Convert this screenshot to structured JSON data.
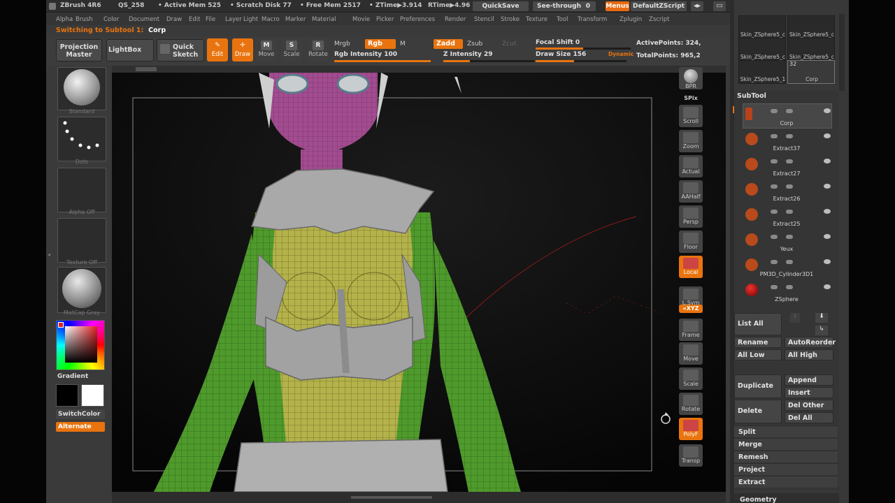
{
  "titlebar": {
    "app": "ZBrush 4R6",
    "qs": "QS_258",
    "active_mem": "• Active Mem 525",
    "scratch": "• Scratch Disk 77",
    "free_mem": "• Free Mem 2517",
    "ztime": "• ZTime▶3.914",
    "rtime": "RTime▶4.96",
    "quicksave": "QuickSave",
    "seethrough": "See-through",
    "seethrough_val": "0",
    "menus": "Menus",
    "script": "DefaultZScript"
  },
  "menu": [
    "Alpha",
    "Brush",
    "Color",
    "Document",
    "Draw",
    "Edit",
    "File",
    "Layer",
    "Light",
    "Macro",
    "Marker",
    "Material",
    "Movie",
    "Picker",
    "Preferences",
    "Render",
    "Stencil",
    "Stroke",
    "Texture",
    "Tool",
    "Transform",
    "Zplugin",
    "Zscript"
  ],
  "status": {
    "prefix": "Switching to Subtool 1:",
    "name": "Corp"
  },
  "shelf": {
    "projection": "Projection Master",
    "lightbox": "LightBox",
    "quick_sketch": "Quick Sketch",
    "edit": "Edit",
    "draw": "Draw",
    "move": "Move",
    "scale": "Scale",
    "rotate": "Rotate",
    "mrgb": "Mrgb",
    "rgb": "Rgb",
    "m": "M",
    "zadd": "Zadd",
    "zsub": "Zsub",
    "zcut": "Zcut",
    "rgb_intensity": "Rgb Intensity 100",
    "z_intensity": "Z Intensity 29",
    "focal_shift": "Focal Shift 0",
    "draw_size": "Draw Size 156",
    "dynamic": "Dynamic",
    "active_points": "ActivePoints: 324,",
    "total_points": "TotalPoints: 965,2",
    "rgb_intensity_level": 1.0,
    "z_intensity_level": 0.29,
    "focal_level": 0.5,
    "draw_size_level": 0.42
  },
  "left": {
    "standard": "Standard",
    "dots": "Dots",
    "alpha_off": "Alpha Off",
    "texture_off": "Texture Off",
    "matcap": "MatCap Gray",
    "gradient": "Gradient",
    "switch_color": "SwitchColor",
    "alternate": "Alternate"
  },
  "righttools": [
    {
      "key": "bpr",
      "label": "BPR"
    },
    {
      "key": "spix",
      "label": "SPix"
    },
    {
      "key": "scroll",
      "label": "Scroll"
    },
    {
      "key": "zoom",
      "label": "Zoom"
    },
    {
      "key": "actual",
      "label": "Actual"
    },
    {
      "key": "aahalf",
      "label": "AAHalf"
    },
    {
      "key": "persp",
      "label": "Persp"
    },
    {
      "key": "floor",
      "label": "Floor"
    },
    {
      "key": "local",
      "label": "Local"
    },
    {
      "key": "lsym",
      "label": "L.Sym"
    },
    {
      "key": "xyz",
      "label": "«XYZ"
    },
    {
      "key": "frame",
      "label": "Frame"
    },
    {
      "key": "move",
      "label": "Move"
    },
    {
      "key": "scale",
      "label": "Scale"
    },
    {
      "key": "rotate",
      "label": "Rotate"
    },
    {
      "key": "polyf",
      "label": "PolyF"
    },
    {
      "key": "transp",
      "label": "Transp"
    }
  ],
  "tools": {
    "thumbs": [
      "Skin_ZSphere5_c",
      "Skin_ZSphere5_c",
      "Skin_ZSphere5_c",
      "Skin_ZSphere5_c",
      "Skin_ZSphere5_1",
      "Corp"
    ],
    "corp_count": "32"
  },
  "subtool": {
    "title": "SubTool",
    "items": [
      "Corp",
      "Extract37",
      "Extract27",
      "Extract26",
      "Extract25",
      "Yeux",
      "PM3D_Cylinder3D1",
      "ZSphere"
    ],
    "list_all": "List All",
    "rename": "Rename",
    "autoreorder": "AutoReorder",
    "all_low": "All Low",
    "all_high": "All High",
    "duplicate": "Duplicate",
    "append": "Append",
    "insert": "Insert",
    "delete": "Delete",
    "del_other": "Del Other",
    "del_all": "Del All",
    "split": "Split",
    "merge": "Merge",
    "remesh": "Remesh",
    "project": "Project",
    "extract": "Extract",
    "geometry": "Geometry"
  },
  "colors": {
    "accent": "#e9740f",
    "body_green": "#5aa032",
    "torso_yellow": "#b8b54a",
    "armor_gray": "#a8a8a8",
    "head_purple": "#a04a8c"
  }
}
